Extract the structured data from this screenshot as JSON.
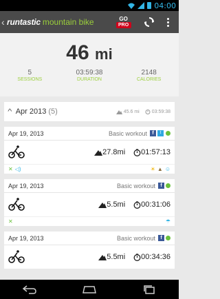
{
  "status_bar": {
    "time": "04:00"
  },
  "action_bar": {
    "back_glyph": "‹",
    "brand": "runtastic",
    "app_name": "mountain bike",
    "go_label": "GO",
    "pro_label": "PRO"
  },
  "summary": {
    "total_value": "46",
    "total_unit": "mi",
    "stats": [
      {
        "value": "5",
        "label": "SESSIONS"
      },
      {
        "value": "03:59:38",
        "label": "DURATION"
      },
      {
        "value": "2148",
        "label": "CALORIES"
      }
    ]
  },
  "month": {
    "label": "Apr 2013",
    "count": "(5)",
    "distance": "45.6 mi",
    "duration": "03:59:38"
  },
  "sessions": [
    {
      "date": "Apr 19, 2013",
      "type": "Basic workout",
      "distance": "27.8mi",
      "duration": "01:57:13"
    },
    {
      "date": "Apr 19, 2013",
      "type": "Basic workout",
      "distance": "5.5mi",
      "duration": "00:31:06"
    },
    {
      "date": "Apr 19, 2013",
      "type": "Basic workout",
      "distance": "5.5mi",
      "duration": "00:34:36"
    }
  ]
}
